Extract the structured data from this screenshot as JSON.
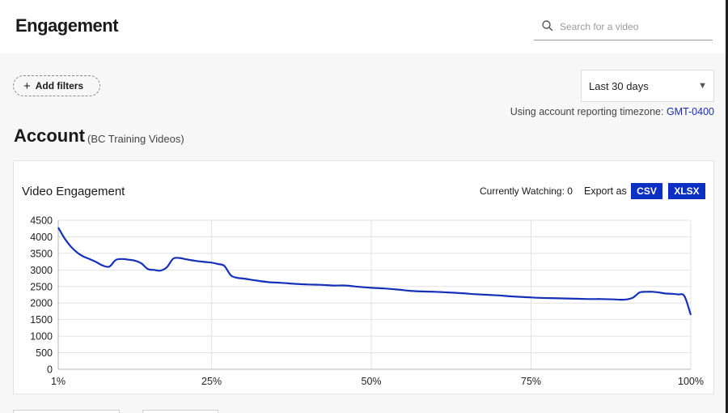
{
  "header": {
    "title": "Engagement",
    "search_placeholder": "Search for a video",
    "search_value": ""
  },
  "filters": {
    "add_label": "Add filters",
    "date_range": "Last 30 days",
    "timezone_prefix": "Using account reporting timezone:",
    "timezone_value": "GMT-0400"
  },
  "account": {
    "title": "Account",
    "subtitle": "(BC Training Videos)"
  },
  "card": {
    "title": "Video Engagement",
    "currently_watching": "Currently Watching: 0",
    "export_label": "Export as",
    "export_csv": "CSV",
    "export_xlsx": "XLSX"
  },
  "colors": {
    "accent": "#0c2fc4",
    "line": "#1530b8",
    "link": "#1b2bb3"
  },
  "icons": {
    "search": "search-icon",
    "add": "plus-icon",
    "dropdown": "caret-down-icon"
  },
  "chart_data": {
    "type": "line",
    "title": "Video Engagement",
    "xlabel": "",
    "ylabel": "",
    "xlim": [
      1,
      100
    ],
    "ylim": [
      0,
      4500
    ],
    "x_ticks": [
      "1%",
      "25%",
      "50%",
      "75%",
      "100%"
    ],
    "x_tick_values": [
      1,
      25,
      50,
      75,
      100
    ],
    "y_ticks": [
      0,
      500,
      1000,
      1500,
      2000,
      2500,
      3000,
      3500,
      4000,
      4500
    ],
    "grid": true,
    "series": [
      {
        "x": [
          1,
          2,
          3,
          4,
          5,
          6,
          7,
          8,
          9,
          10,
          11,
          12,
          13,
          14,
          15,
          16,
          17,
          18,
          19,
          20,
          21,
          22,
          23,
          24,
          25,
          26,
          27,
          28,
          29,
          30,
          32,
          34,
          36,
          38,
          40,
          42,
          44,
          46,
          48,
          50,
          52,
          54,
          56,
          58,
          60,
          62,
          64,
          66,
          68,
          70,
          72,
          74,
          76,
          78,
          80,
          82,
          84,
          86,
          88,
          89,
          90,
          91,
          92,
          93,
          94,
          95,
          96,
          97,
          98,
          99,
          100
        ],
        "values": [
          4280,
          3950,
          3700,
          3520,
          3400,
          3320,
          3230,
          3130,
          3100,
          3300,
          3330,
          3310,
          3280,
          3200,
          3030,
          3000,
          2980,
          3080,
          3340,
          3360,
          3320,
          3290,
          3260,
          3240,
          3220,
          3180,
          3120,
          2840,
          2760,
          2740,
          2680,
          2630,
          2610,
          2580,
          2560,
          2550,
          2530,
          2530,
          2490,
          2460,
          2440,
          2410,
          2370,
          2350,
          2340,
          2320,
          2300,
          2270,
          2250,
          2230,
          2200,
          2180,
          2160,
          2150,
          2140,
          2130,
          2120,
          2120,
          2110,
          2100,
          2110,
          2170,
          2320,
          2340,
          2340,
          2320,
          2290,
          2280,
          2260,
          2210,
          1640
        ]
      }
    ]
  }
}
